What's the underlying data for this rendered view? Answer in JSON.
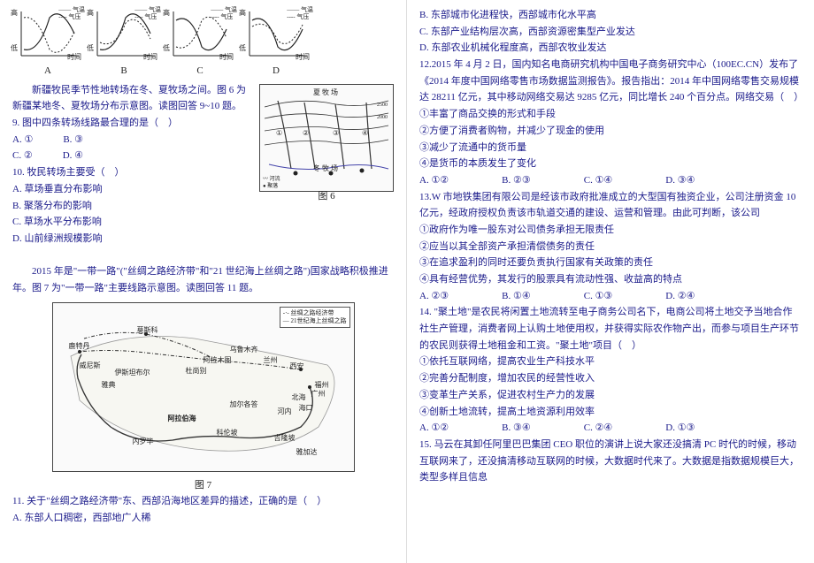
{
  "graphs": {
    "legend1": "—— 气温",
    "legend2": "---- 气压",
    "xaxis": "时间",
    "yaxis_left": "高",
    "yaxis_left2": "低",
    "labels": [
      "A",
      "B",
      "C",
      "D"
    ]
  },
  "left": {
    "intro1": "新疆牧民季节性地转场在冬、夏牧场之间。图 6 为新疆某地冬、夏牧场分布示意图。读图回答 9~10 题。",
    "q9": "9. 图中四条转场线路最合理的是（　）",
    "q9_opts": {
      "a": "A. ①",
      "b": "B. ③",
      "c": "C. ②",
      "d": "D. ④"
    },
    "q10": "10. 牧民转场主要受（　）",
    "q10_a": "A. 草场垂直分布影响",
    "q10_b": "B. 聚落分布的影响",
    "q10_c": "C. 草场水平分布影响",
    "q10_d": "D. 山前绿洲规模影响",
    "map6_caption": "图 6",
    "map6_top": "夏 牧 场",
    "map6_bottom": "冬 牧 场",
    "map6_marks": {
      "a": "①",
      "b": "②",
      "c": "③",
      "d": "④"
    },
    "map6_legend": {
      "river": "河流",
      "village": "聚落"
    },
    "intro2": "2015 年是\"一带一路\"(\"丝绸之路经济带\"和\"21 世纪海上丝绸之路\")国家战略积极推进年。图 7 为\"一带一路\"主要线路示意图。读图回答 11 题。",
    "map7_caption": "图 7",
    "map7_legend1": "-·- 丝绸之路经济带",
    "map7_legend2": "— 21世纪海上丝绸之路",
    "map7_places": {
      "moscow": "莫斯科",
      "xian": "西安",
      "rotterdam": "鹿特丹",
      "venice": "威尼斯",
      "istanbul": "伊斯坦布尔",
      "almaty": "阿拉木图",
      "lanzhou": "兰州",
      "urumqi": "乌鲁木齐",
      "dushanbe": "杜尚别",
      "athens": "雅典",
      "fuzhou": "福州",
      "beihai": "北海",
      "guangzhou": "广州",
      "haikou": "海口",
      "hanoi": "河内",
      "kolkata": "加尔各答",
      "colombo": "科伦坡",
      "nairobi": "内罗毕",
      "kualalumpur": "吉隆坡",
      "jakarta": "雅加达",
      "arabiansea": "阿拉伯海"
    },
    "q11": "11. 关于\"丝绸之路经济带\"东、西部沿海地区差异的描述，正确的是（　）",
    "q11_a": "A. 东部人口稠密，西部地广人稀"
  },
  "right": {
    "q11_b": "B. 东部城市化进程快，西部城市化水平高",
    "q11_c": "C. 东部产业结构层次高，西部资源密集型产业发达",
    "q11_d": "D. 东部农业机械化程度高，西部农牧业发达",
    "q12_intro": "12.2015 年 4 月 2 日，国内知名电商研究机构中国电子商务研究中心（100EC.CN）发布了《2014 年度中国网络零售市场数据监测报告》。报告指出：2014 年中国网络零售交易规模达 28211 亿元，其中移动网络交易达 9285 亿元，同比增长 240 个百分点。网络交易（　）",
    "q12_1": "①丰富了商品交换的形式和手段",
    "q12_2": "②方便了消费者购物，并减少了现金的使用",
    "q12_3": "③减少了流通中的货币量",
    "q12_4": "④是货币的本质发生了变化",
    "q12_opts": {
      "a": "A. ①②",
      "b": "B. ②③",
      "c": "C. ①④",
      "d": "D. ③④"
    },
    "q13_intro": "13.W 市地铁集团有限公司是经该市政府批准成立的大型国有独资企业，公司注册资金 10 亿元，经政府授权负责该市轨道交通的建设、运营和管理。由此可判断，该公司",
    "q13_1": "①政府作为唯一股东对公司债务承担无限责任",
    "q13_2": "②应当以其全部资产承担清偿债务的责任",
    "q13_3": "③在追求盈利的同时还要负责执行国家有关政策的责任",
    "q13_4": "④具有经营优势，其发行的股票具有流动性强、收益高的特点",
    "q13_opts": {
      "a": "A. ②③",
      "b": "B. ①④",
      "c": "C. ①③",
      "d": "D. ②④"
    },
    "q14_intro": "14. \"聚土地\"是农民将闲置土地流转至电子商务公司名下，电商公司将土地交予当地合作社生产管理，消费者网上认购土地使用权，并获得实际农作物产出，而参与项目生产环节的农民则获得土地租金和工资。\"聚土地\"项目（　）",
    "q14_1": "①依托互联网络，提高农业生产科技水平",
    "q14_2": "②完善分配制度，增加农民的经营性收入",
    "q14_3": "③变革生产关系，促进农村生产力的发展",
    "q14_4": "④创新土地流转，提高土地资源利用效率",
    "q14_opts": {
      "a": "A. ①②",
      "b": "B. ③④",
      "c": "C. ②④",
      "d": "D. ①③"
    },
    "q15": "15. 马云在其卸任阿里巴巴集团 CEO 职位的演讲上说大家还没搞清 PC 时代的时候，移动互联网来了，还没搞清移动互联网的时候，大数据时代来了。大数据是指数据规模巨大，类型多样且信息"
  }
}
